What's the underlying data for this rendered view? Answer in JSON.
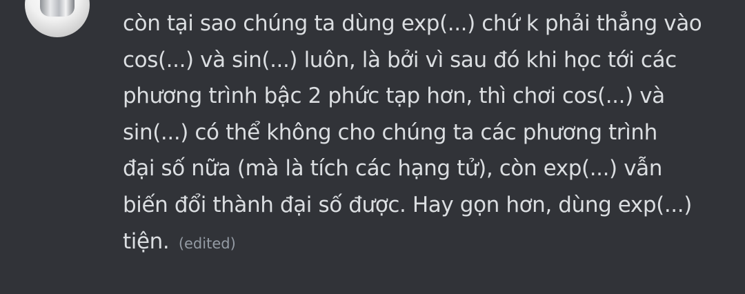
{
  "message": {
    "lines": [
      "còn tại sao chúng ta dùng exp(...) chứ k phải thẳng vào",
      "cos(...) và sin(...) luôn, là bởi vì sau đó khi học tới các",
      "phương trình bậc 2 phức tạp hơn, thì chơi cos(...) và",
      "sin(...) có thể không cho chúng ta các phương trình",
      "đại số nữa (mà là tích các hạng tử), còn exp(...) vẫn",
      "biến đổi thành đại số được. Hay gọn hơn, dùng exp(...)",
      "tiện."
    ],
    "edited_label": "(edited)"
  },
  "colors": {
    "background": "#313338",
    "text": "#dbdee1",
    "muted": "#949ba4"
  }
}
